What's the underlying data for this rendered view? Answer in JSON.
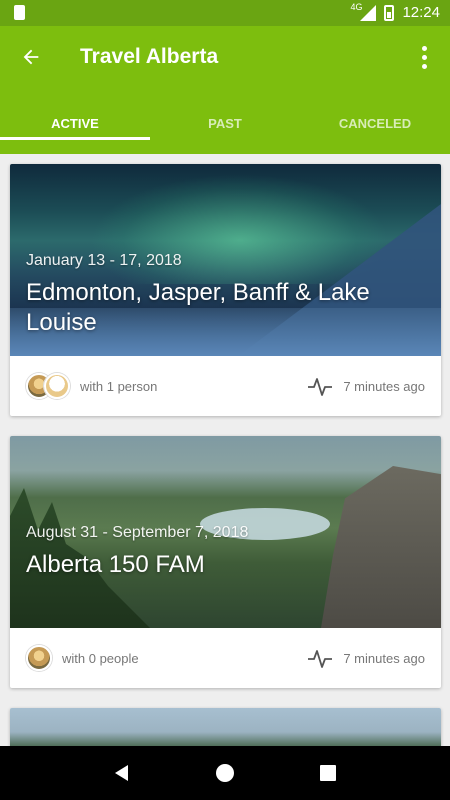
{
  "status_bar": {
    "time": "12:24",
    "network": "4G"
  },
  "app_bar": {
    "title": "Travel Alberta"
  },
  "tabs": [
    {
      "label": "ACTIVE",
      "active": true
    },
    {
      "label": "PAST",
      "active": false
    },
    {
      "label": "CANCELED",
      "active": false
    }
  ],
  "trips": [
    {
      "date": "January 13 - 17, 2018",
      "name": "Edmonton, Jasper, Banff & Lake Louise",
      "with": "with 1 person",
      "updated": "7 minutes ago"
    },
    {
      "date": "August 31 - September 7, 2018",
      "name": "Alberta 150 FAM",
      "with": "with 0 people",
      "updated": "7 minutes ago"
    }
  ],
  "colors": {
    "primary": "#7dbe0e",
    "primary_dark": "#6aa512"
  },
  "icons": [
    "back-arrow-icon",
    "overflow-menu-icon",
    "activity-pulse-icon",
    "nav-back-icon",
    "nav-home-icon",
    "nav-recents-icon"
  ]
}
